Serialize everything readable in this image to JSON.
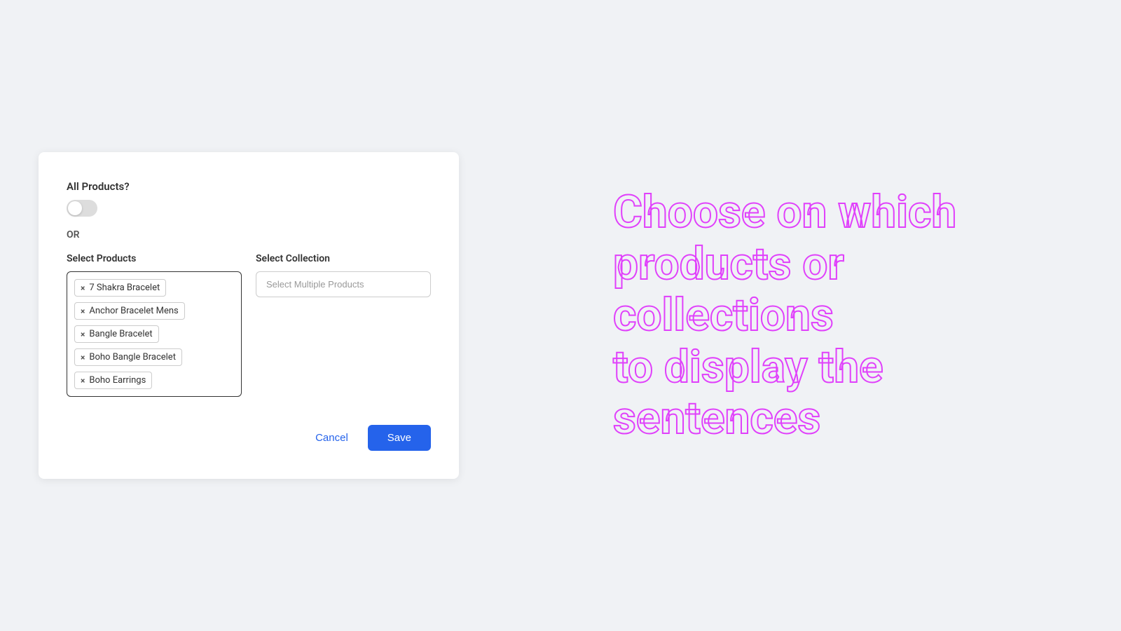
{
  "dialog": {
    "all_products_label": "All Products?",
    "toggle_state": "off",
    "or_label": "OR",
    "select_products_label": "Select Products",
    "select_collection_label": "Select Collection",
    "collection_placeholder": "Select Multiple Products",
    "tags": [
      {
        "id": "tag-1",
        "label": "7 Shakra Bracelet"
      },
      {
        "id": "tag-2",
        "label": "Anchor Bracelet Mens"
      },
      {
        "id": "tag-3",
        "label": "Bangle Bracelet"
      },
      {
        "id": "tag-4",
        "label": "Boho Bangle Bracelet"
      },
      {
        "id": "tag-5",
        "label": "Boho Earrings"
      }
    ],
    "cancel_label": "Cancel",
    "save_label": "Save"
  },
  "hero": {
    "line1": "Choose on which",
    "line2": "products or collections",
    "line3": "to display the",
    "line4": "sentences"
  },
  "icons": {
    "close": "×"
  }
}
